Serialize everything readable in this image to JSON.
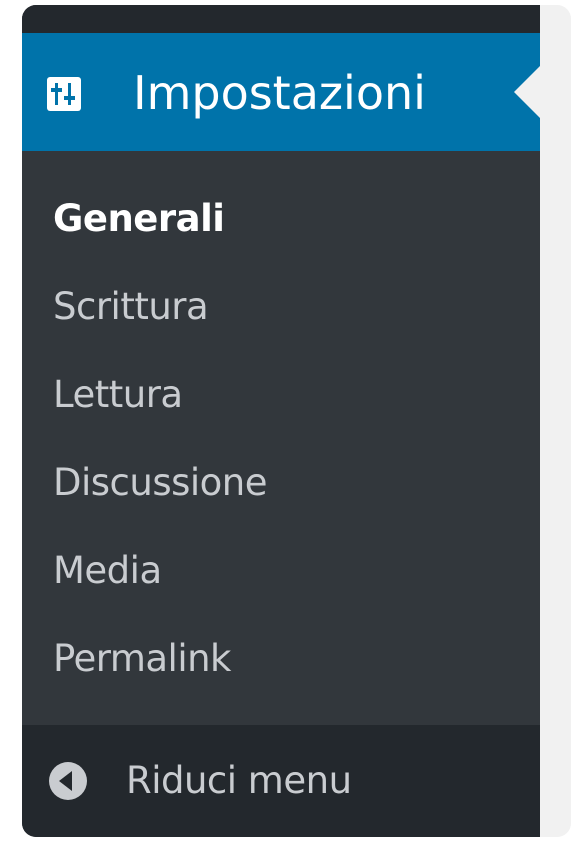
{
  "menu": {
    "header": {
      "label": "Impostazioni",
      "icon": "settings-sliders-icon"
    },
    "submenu": [
      {
        "label": "Generali",
        "current": true
      },
      {
        "label": "Scrittura",
        "current": false
      },
      {
        "label": "Lettura",
        "current": false
      },
      {
        "label": "Discussione",
        "current": false
      },
      {
        "label": "Media",
        "current": false
      },
      {
        "label": "Permalink",
        "current": false
      }
    ],
    "collapse": {
      "label": "Riduci menu",
      "icon": "collapse-left-icon"
    }
  },
  "colors": {
    "menu_bg": "#32373c",
    "header_bg": "#0073aa",
    "collapse_bg": "#23282d",
    "text": "#c9ccd0",
    "text_current": "#ffffff"
  }
}
